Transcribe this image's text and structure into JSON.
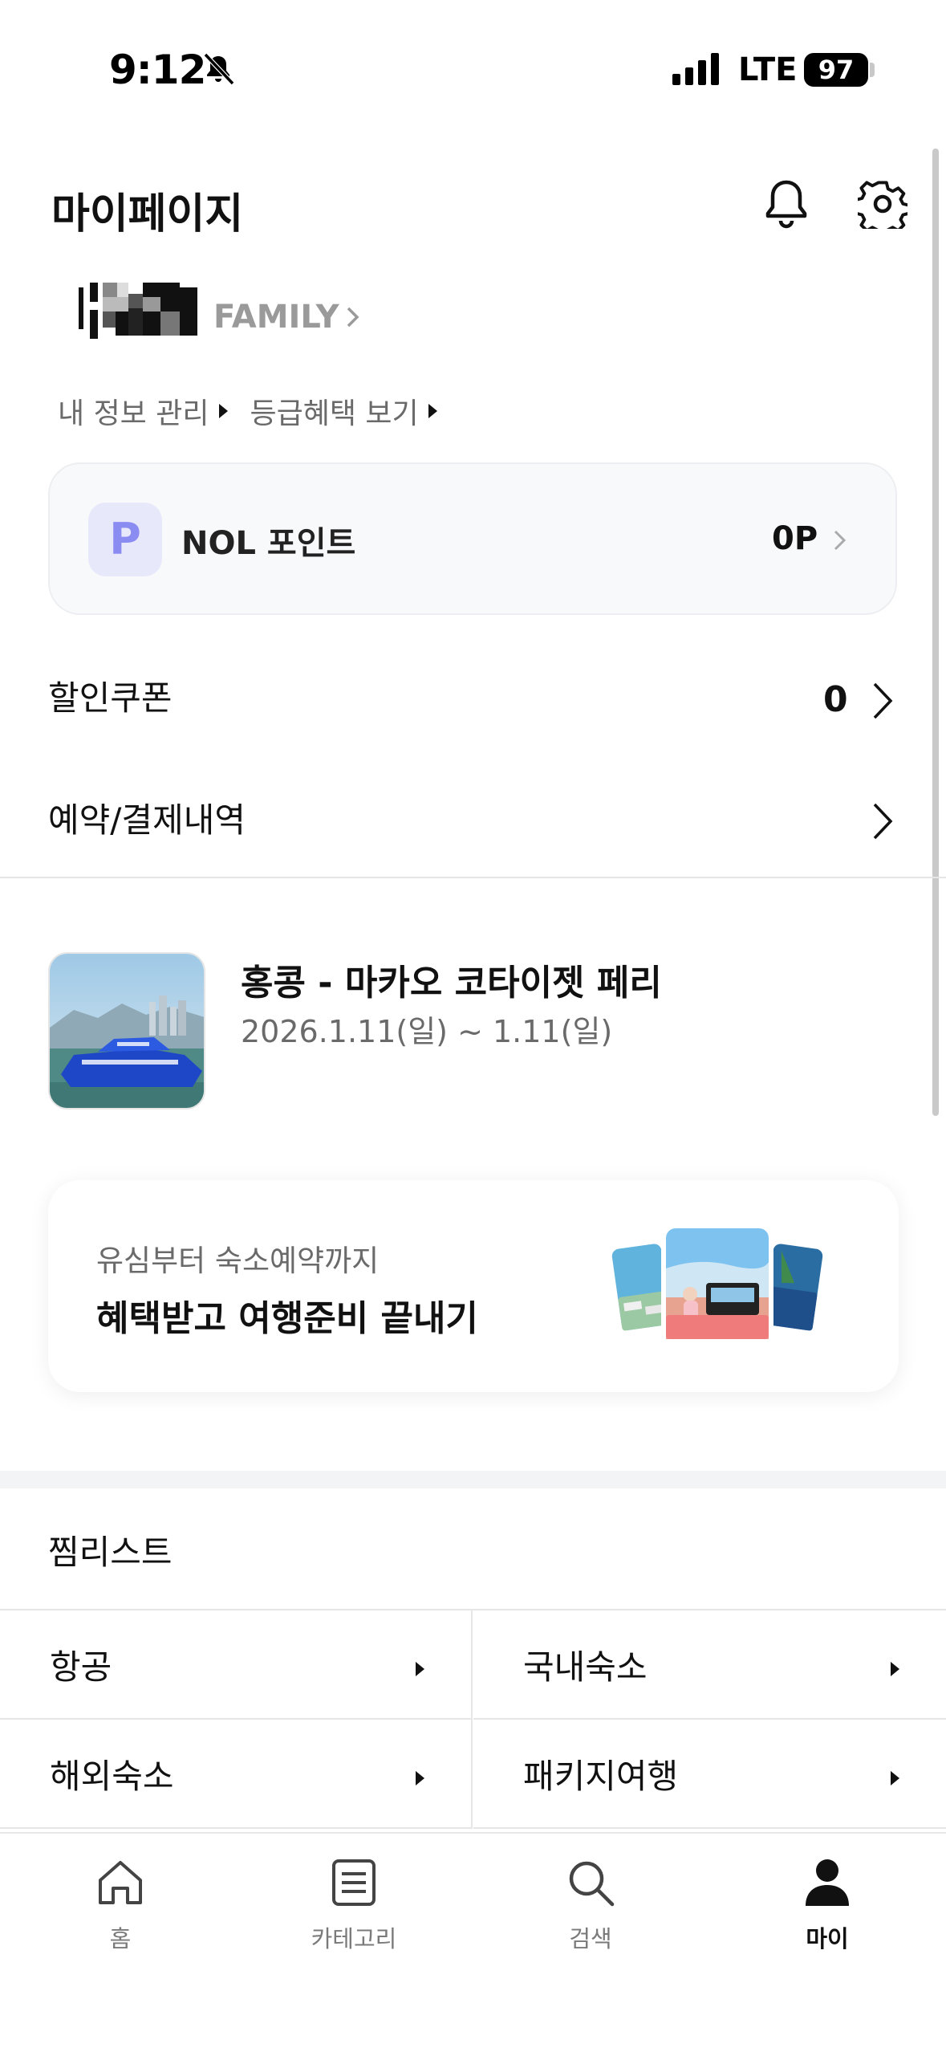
{
  "status_bar": {
    "time": "9:12",
    "network": "LTE",
    "battery": "97"
  },
  "header": {
    "title": "마이페이지"
  },
  "profile": {
    "grade": "FAMILY",
    "links": [
      "내 정보 관리",
      "등급혜택 보기"
    ]
  },
  "points": {
    "badge": "P",
    "label": "NOL 포인트",
    "value": "0P"
  },
  "menu": {
    "coupon_label": "할인쿠폰",
    "coupon_count": "0",
    "booking_label": "예약/결제내역"
  },
  "booking": {
    "title": "홍콩 - 마카오 코타이젯 페리",
    "date": "2026.1.11(일) ~ 1.11(일)"
  },
  "promo": {
    "subtitle": "유심부터 숙소예약까지",
    "title": "혜택받고 여행준비 끝내기"
  },
  "wishlist": {
    "title": "찜리스트",
    "items": [
      "항공",
      "국내숙소",
      "해외숙소",
      "패키지여행"
    ]
  },
  "bottom_nav": {
    "items": [
      {
        "label": "홈",
        "icon": "home-icon",
        "active": false
      },
      {
        "label": "카테고리",
        "icon": "list-icon",
        "active": false
      },
      {
        "label": "검색",
        "icon": "search-icon",
        "active": false
      },
      {
        "label": "마이",
        "icon": "person-icon",
        "active": true
      }
    ]
  }
}
